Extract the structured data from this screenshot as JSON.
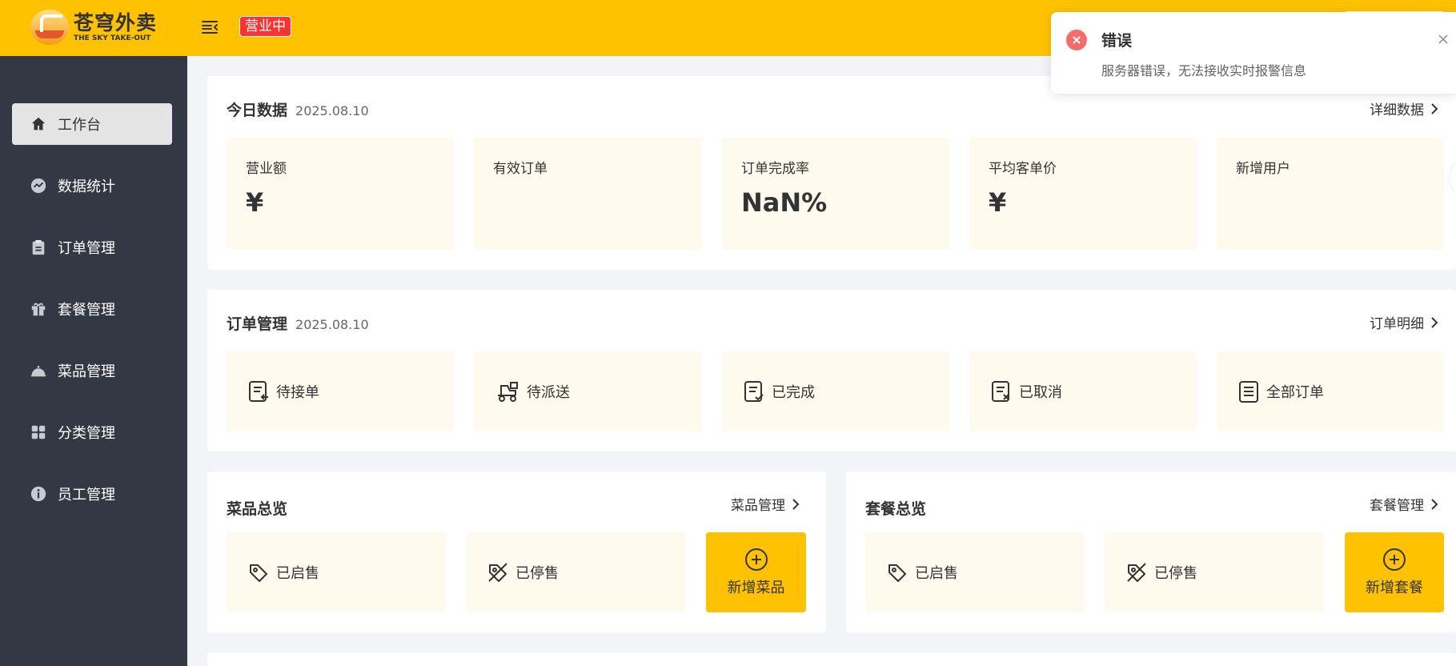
{
  "header": {
    "logo_cn": "苍穹外卖",
    "logo_en": "THE SKY TAKE-OUT",
    "status_tag": "营业中"
  },
  "sidebar": {
    "items": [
      {
        "label": "工作台",
        "icon": "home-icon",
        "active": true
      },
      {
        "label": "数据统计",
        "icon": "chart-icon",
        "active": false
      },
      {
        "label": "订单管理",
        "icon": "clipboard-icon",
        "active": false
      },
      {
        "label": "套餐管理",
        "icon": "gift-icon",
        "active": false
      },
      {
        "label": "菜品管理",
        "icon": "dish-cover-icon",
        "active": false
      },
      {
        "label": "分类管理",
        "icon": "grid-icon",
        "active": false
      },
      {
        "label": "员工管理",
        "icon": "info-icon",
        "active": false
      }
    ]
  },
  "today": {
    "title": "今日数据",
    "date": "2025.08.10",
    "link": "详细数据",
    "tiles": [
      {
        "label": "营业额",
        "value": "¥"
      },
      {
        "label": "有效订单",
        "value": ""
      },
      {
        "label": "订单完成率",
        "value": "NaN%"
      },
      {
        "label": "平均客单价",
        "value": "¥"
      },
      {
        "label": "新增用户",
        "value": ""
      }
    ]
  },
  "orders": {
    "title": "订单管理",
    "date": "2025.08.10",
    "link": "订单明细",
    "items": [
      {
        "label": "待接单",
        "icon": "order-pending-icon"
      },
      {
        "label": "待派送",
        "icon": "delivery-icon"
      },
      {
        "label": "已完成",
        "icon": "order-done-icon"
      },
      {
        "label": "已取消",
        "icon": "order-cancel-icon"
      },
      {
        "label": "全部订单",
        "icon": "order-list-icon"
      }
    ]
  },
  "dishes": {
    "title": "菜品总览",
    "link": "菜品管理",
    "on_sale": "已启售",
    "off_sale": "已停售",
    "add": "新增菜品"
  },
  "setmeals": {
    "title": "套餐总览",
    "link": "套餐管理",
    "on_sale": "已启售",
    "off_sale": "已停售",
    "add": "新增套餐"
  },
  "toast": {
    "title": "错误",
    "message": "服务器错误，无法接收实时报警信息"
  },
  "colors": {
    "brand": "#ffc200",
    "sidebar": "#343744",
    "tile": "#fffaee",
    "error": "#f56c6c",
    "status_red": "#fd3333"
  }
}
